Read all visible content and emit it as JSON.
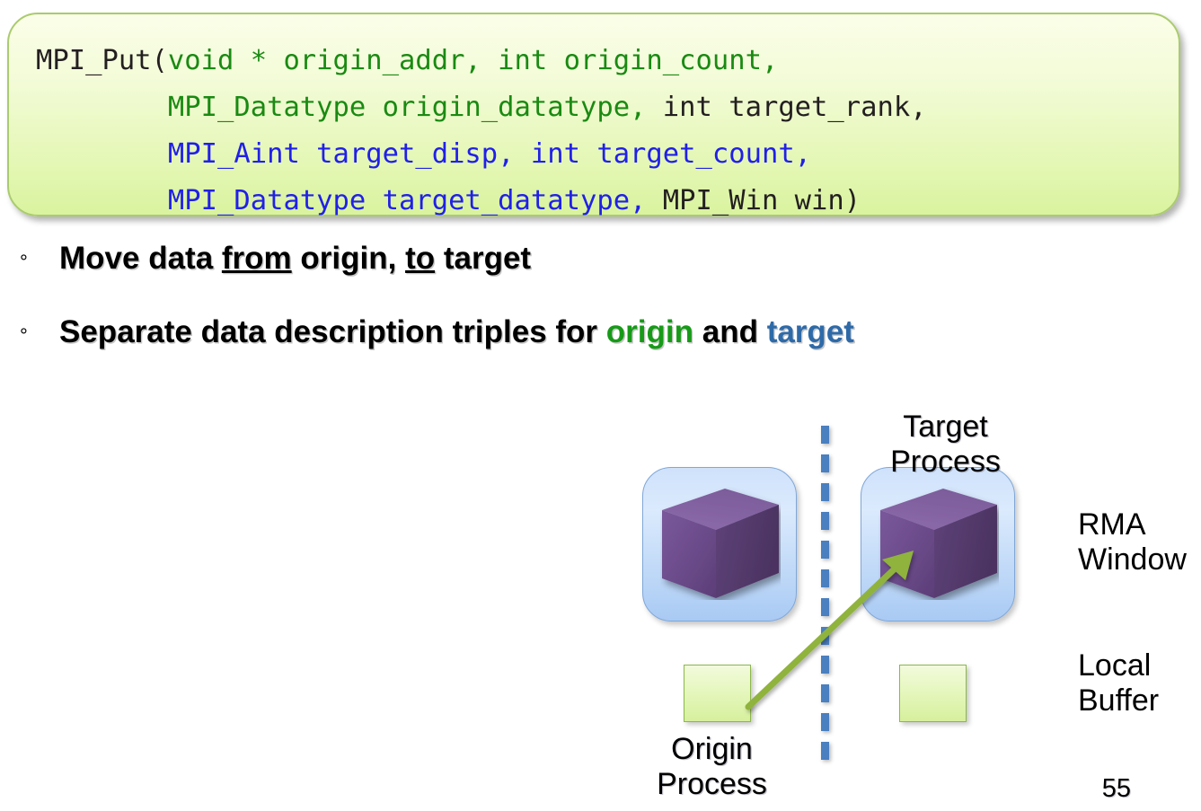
{
  "slide": {
    "number": "55"
  },
  "code_box": {
    "lines": [
      {
        "tokens": [
          {
            "text": "MPI_Put(",
            "color": "black"
          },
          {
            "text": "void * origin_addr, int origin_count,",
            "color": "green"
          }
        ]
      },
      {
        "tokens": [
          {
            "text": "        ",
            "color": "black"
          },
          {
            "text": "MPI_Datatype origin_datatype,",
            "color": "green"
          },
          {
            "text": " int target_rank,",
            "color": "black"
          }
        ]
      },
      {
        "tokens": [
          {
            "text": "        ",
            "color": "black"
          },
          {
            "text": "MPI_Aint target_disp, int target_count,",
            "color": "blue"
          }
        ]
      },
      {
        "tokens": [
          {
            "text": "        ",
            "color": "black"
          },
          {
            "text": "MPI_Datatype target_datatype,",
            "color": "blue"
          },
          {
            "text": " MPI_Win win)",
            "color": "black"
          }
        ]
      }
    ],
    "colors": {
      "black": "#231f20",
      "green": "#1a8a12",
      "blue": "#2020e8",
      "border": "#aacb6e",
      "fill_top": "#fbfee9",
      "fill_bottom": "#d9f39f"
    }
  },
  "bullets": [
    {
      "marker": "°",
      "segments": [
        {
          "text": "Move data ",
          "style": "plain"
        },
        {
          "text": "from",
          "style": "underline"
        },
        {
          "text": " origin, ",
          "style": "plain"
        },
        {
          "text": "to",
          "style": "underline"
        },
        {
          "text": " target",
          "style": "plain"
        }
      ]
    },
    {
      "marker": "°",
      "segments": [
        {
          "text": "Separate data description triples for ",
          "style": "plain"
        },
        {
          "text": "origin",
          "style": "origin"
        },
        {
          "text": " and ",
          "style": "plain"
        },
        {
          "text": "target",
          "style": "target"
        }
      ]
    }
  ],
  "diagram": {
    "labels": {
      "target_process": "Target\nProcess",
      "origin_process": "Origin\nProcess",
      "rma_window": "RMA\nWindow",
      "local_buffer": "Local\nBuffer"
    },
    "icon_names": {
      "rma_window_box": "rma-window-box",
      "cube": "memory-cube-icon",
      "local_buffer_box": "local-buffer-box",
      "divider": "process-divider-dashed-line",
      "arrow": "data-transfer-arrow"
    },
    "colors": {
      "window_fill": "#cfe2fb",
      "window_border": "#7fa7d8",
      "cube_front": "#6b4b8a",
      "cube_top": "#8d6bab",
      "cube_side": "#54386d",
      "buffer_fill": "#e6f7bf",
      "buffer_border": "#8cb84c",
      "divider": "#4a7fc0",
      "arrow": "#8fb33c"
    },
    "origin_label_colors": {
      "origin": "#179a18",
      "target": "#2e6aa8"
    }
  }
}
